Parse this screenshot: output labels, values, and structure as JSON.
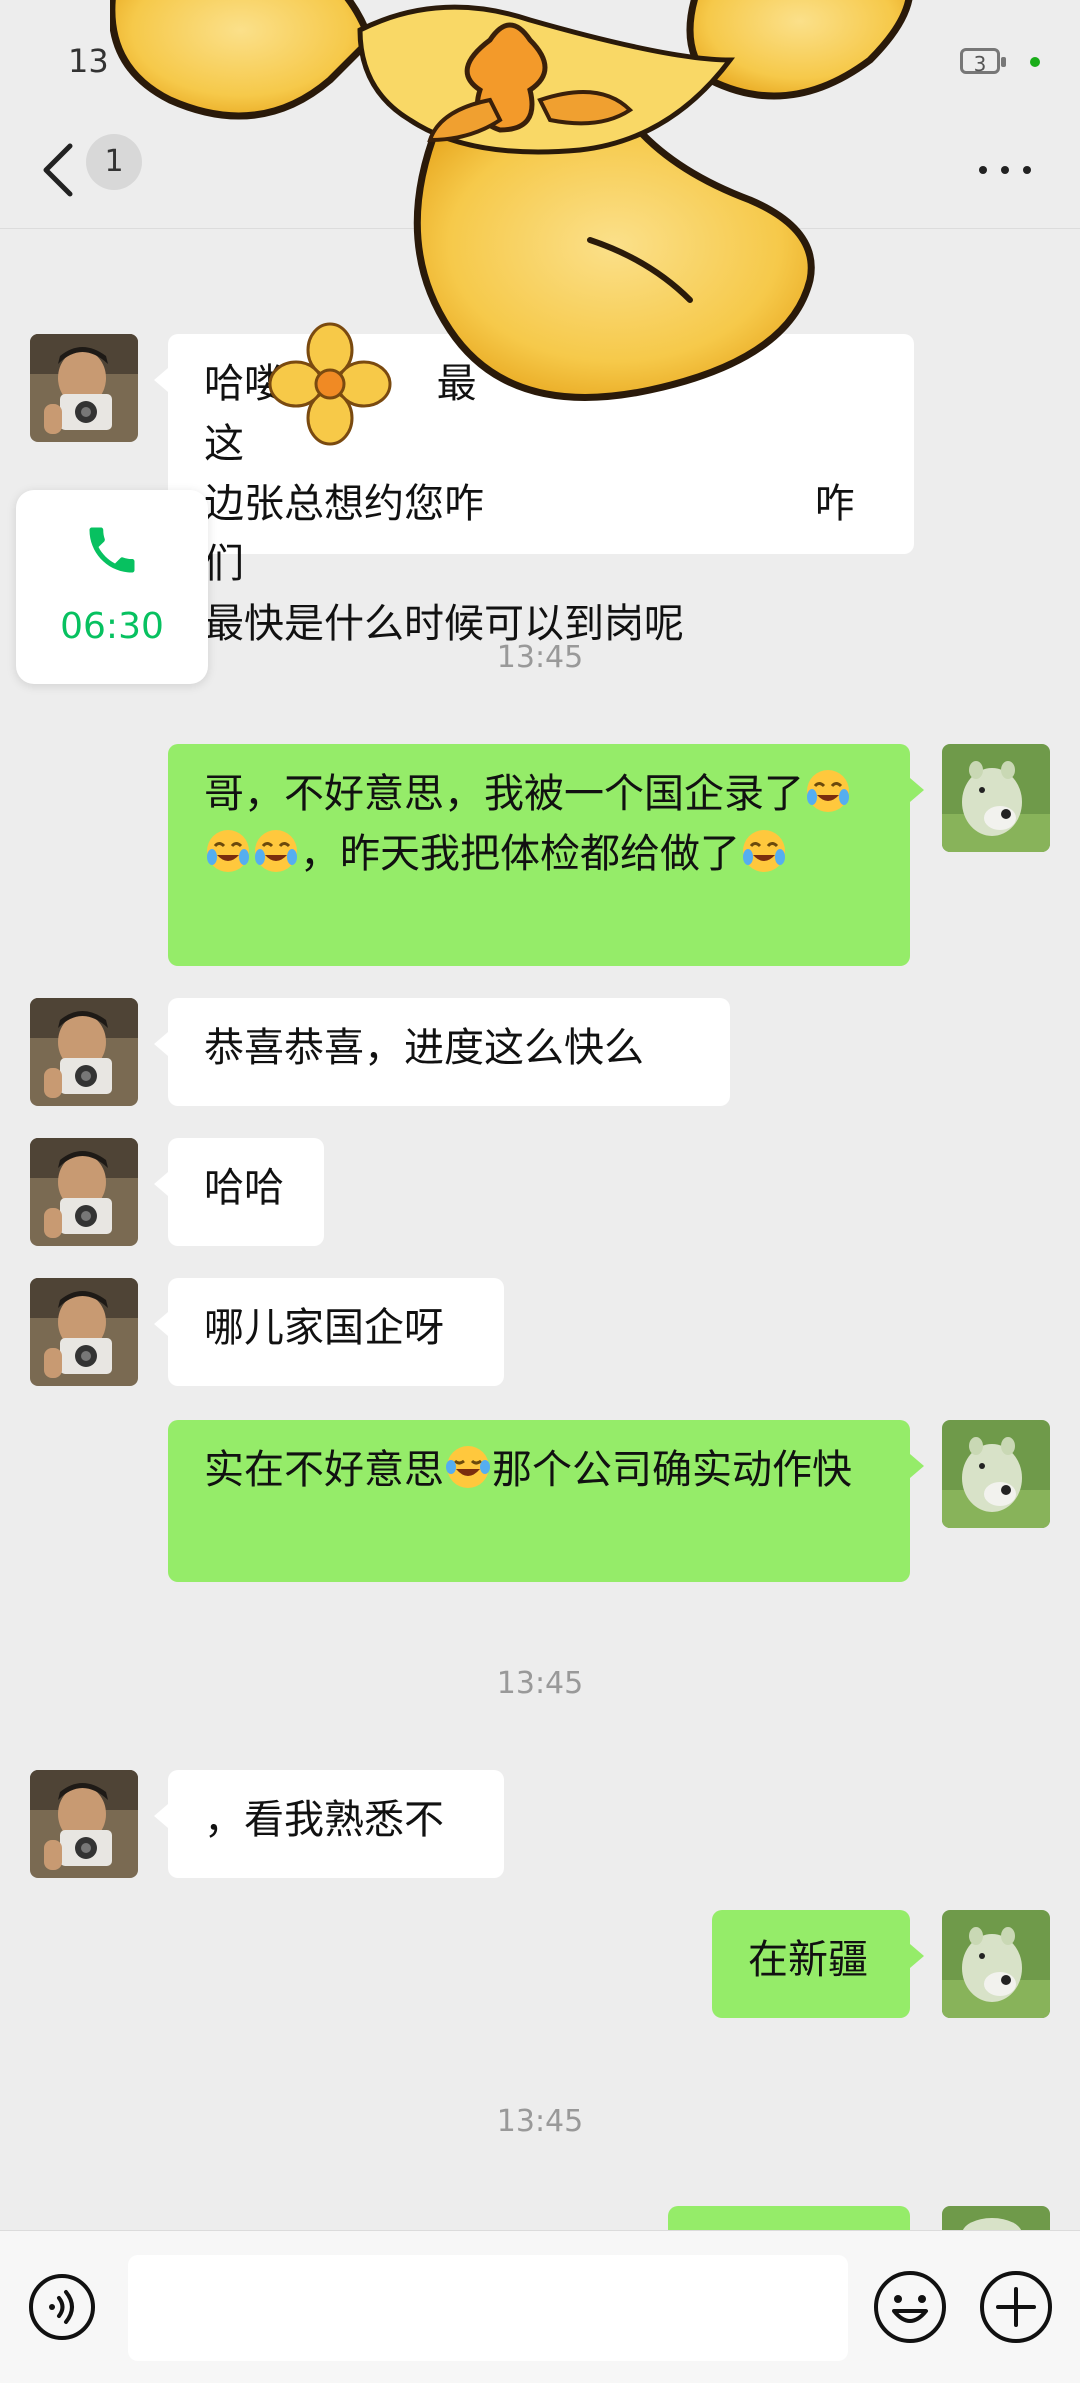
{
  "status_bar": {
    "time": "13",
    "battery": "3"
  },
  "header": {
    "unread_count": "1"
  },
  "call": {
    "duration": "06:30"
  },
  "timestamps": [
    "13:45",
    "13:45",
    "13:45"
  ],
  "messages": [
    {
      "side": "left",
      "text": "哈喽            最                              这\n边张总想约您咋                          咋们\n最快是什么时候可以到岗呢"
    },
    {
      "side": "right",
      "part1": "哥，不好意思，我被一个国企录了",
      "part2": "，昨天我把体检都给做了"
    },
    {
      "side": "left",
      "text": "恭喜恭喜，进度这么快么"
    },
    {
      "side": "left",
      "text": "哈哈"
    },
    {
      "side": "left",
      "text": "哪儿家国企呀"
    },
    {
      "side": "right",
      "part1": "实在不好意思",
      "part2": "那个公司确实动作快"
    },
    {
      "side": "left",
      "text": "，看我熟悉不"
    },
    {
      "side": "right",
      "text": "在新疆"
    }
  ]
}
